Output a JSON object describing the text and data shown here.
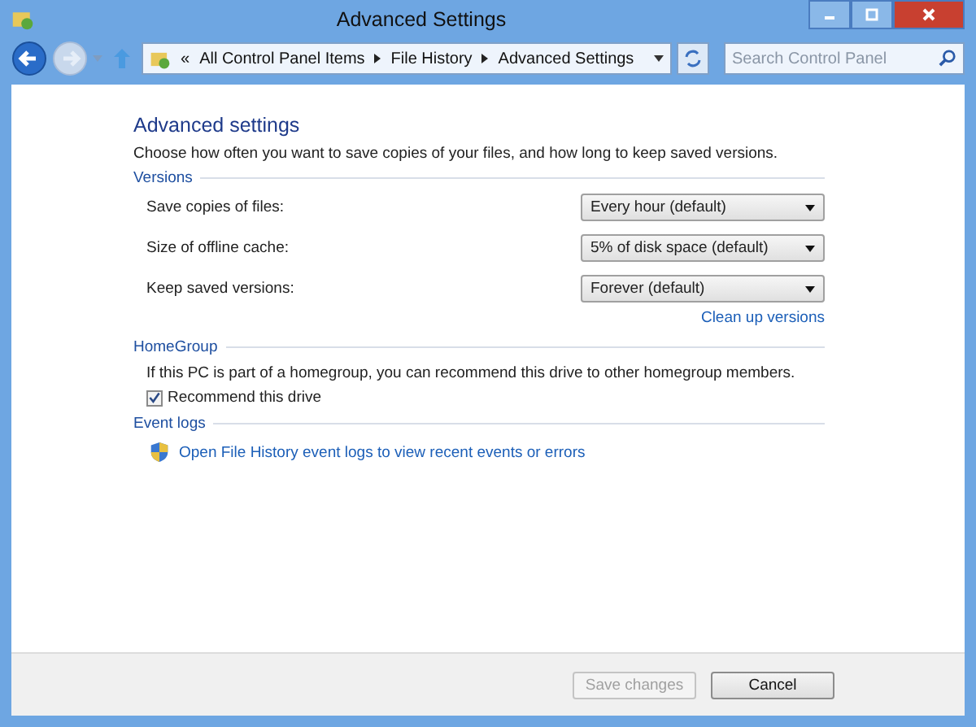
{
  "window": {
    "title": "Advanced Settings"
  },
  "address": {
    "overflow": "«",
    "breadcrumb": [
      "All Control Panel Items",
      "File History",
      "Advanced Settings"
    ]
  },
  "search": {
    "placeholder": "Search Control Panel"
  },
  "heading": "Advanced settings",
  "description": "Choose how often you want to save copies of your files, and how long to keep saved versions.",
  "versions": {
    "title": "Versions",
    "settings": [
      {
        "label": "Save copies of files:",
        "value": "Every hour (default)"
      },
      {
        "label": "Size of offline cache:",
        "value": "5% of disk space (default)"
      },
      {
        "label": "Keep saved versions:",
        "value": "Forever (default)"
      }
    ],
    "link": "Clean up versions"
  },
  "homegroup": {
    "title": "HomeGroup",
    "description": "If this PC is part of a homegroup, you can recommend this drive to other homegroup members.",
    "option": {
      "label": "Recommend this drive",
      "checked": true
    }
  },
  "event_logs": {
    "title": "Event logs",
    "link": "Open File History event logs to view recent events or errors"
  },
  "buttons": [
    {
      "label": "Save changes",
      "disabled": true
    },
    {
      "label": "Cancel",
      "disabled": false
    }
  ]
}
